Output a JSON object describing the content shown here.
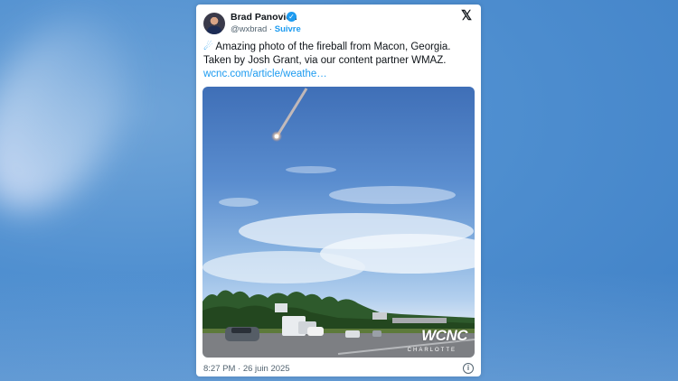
{
  "author": {
    "name": "Brad Panovich",
    "handle": "@wxbrad",
    "separator": "·",
    "follow_label": "Suivre"
  },
  "tweet": {
    "line1": "Amazing photo of the fireball from Macon, Georgia.",
    "line2": "Taken by Josh Grant, via our content partner WMAZ.",
    "link": "wcnc.com/article/weathe…"
  },
  "photo": {
    "watermark": "WCNC",
    "watermark_sub": "CHARLOTTE"
  },
  "footer": {
    "timestamp": "8:27 PM · 26 juin 2025"
  },
  "icons": {
    "verified": "verified-badge-icon",
    "platform": "x-logo-icon",
    "emoji": "comet-icon",
    "info": "info-icon"
  },
  "colors": {
    "accent": "#1d9bf0",
    "text": "#0f1419",
    "muted": "#536471"
  }
}
